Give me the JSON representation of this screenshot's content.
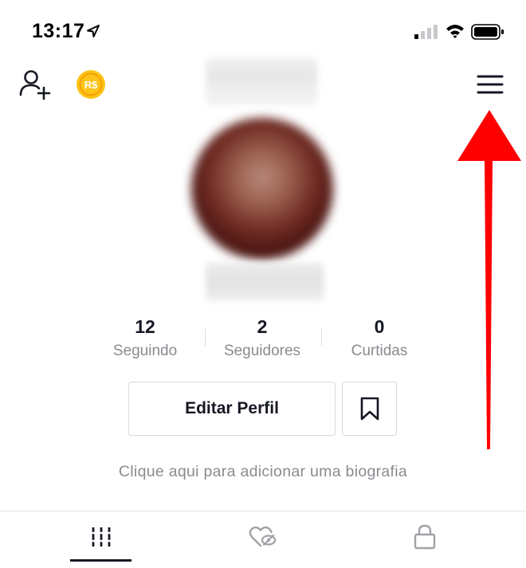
{
  "status_bar": {
    "time": "13:17",
    "icons": [
      "location-arrow-icon",
      "signal-icon",
      "wifi-icon",
      "battery-icon"
    ]
  },
  "header": {
    "add_user_icon": "person-add-icon",
    "coin_icon": "coin-icon",
    "coin_label": "R$",
    "menu_icon": "hamburger-menu-icon"
  },
  "profile": {
    "stats": [
      {
        "value": "12",
        "label": "Seguindo"
      },
      {
        "value": "2",
        "label": "Seguidores"
      },
      {
        "value": "0",
        "label": "Curtidas"
      }
    ],
    "edit_button_label": "Editar Perfil",
    "favorites_icon": "bookmark-icon",
    "bio_placeholder": "Clique aqui para adicionar uma biografia"
  },
  "tabs": [
    {
      "icon": "videos-grid-icon",
      "selected": true
    },
    {
      "icon": "liked-hidden-icon",
      "selected": false
    },
    {
      "icon": "lock-icon",
      "selected": false
    }
  ],
  "annotation": {
    "icon": "red-arrow-up-icon",
    "color": "#ff0000"
  },
  "colors": {
    "text_primary": "#161823",
    "text_secondary": "#8a8b91",
    "coin": "#fcc419",
    "border": "#d9d9db"
  }
}
